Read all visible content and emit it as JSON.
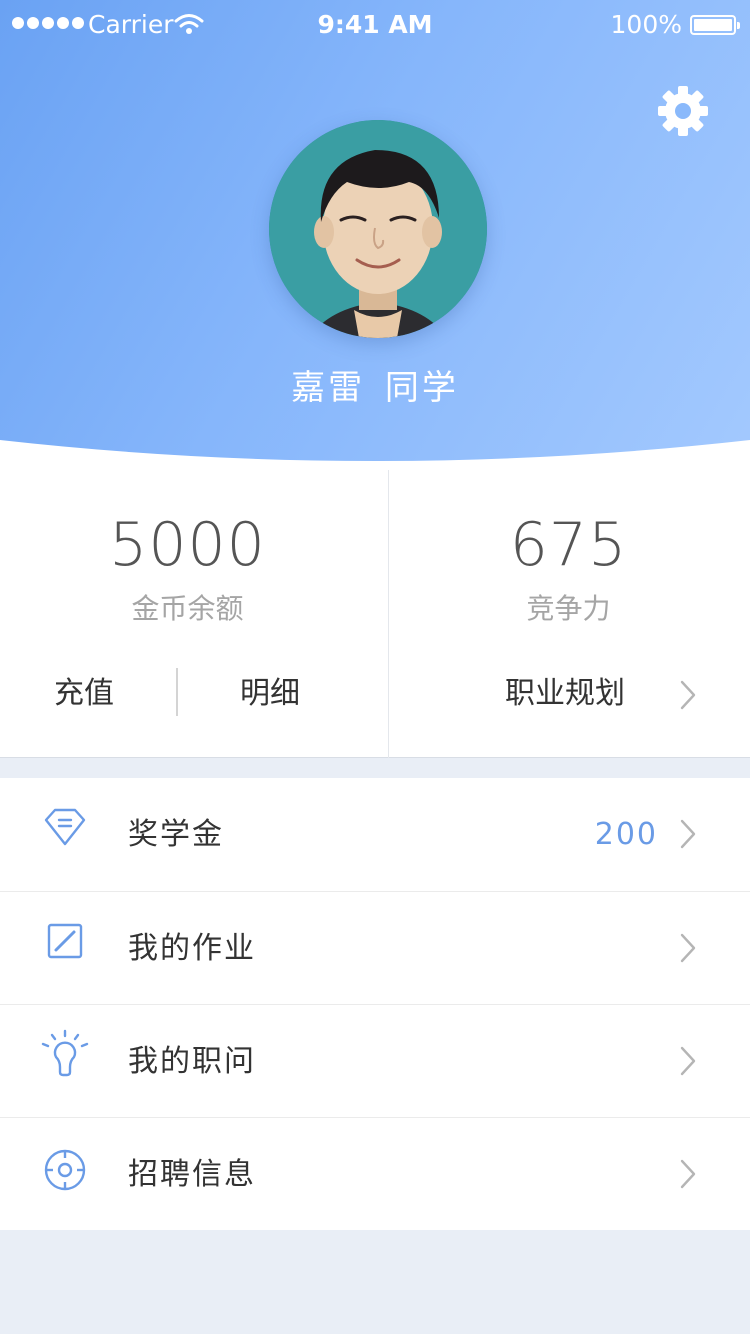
{
  "status_bar": {
    "carrier": "Carrier",
    "time": "9:41 AM",
    "battery": "100%"
  },
  "profile": {
    "name": "嘉雷 同学",
    "settings_icon": "gear-icon",
    "avatar_icon": "avatar-photo"
  },
  "stats": {
    "coins": {
      "value": "5000",
      "label": "金币余额"
    },
    "competitiveness": {
      "value": "675",
      "label": "竞争力"
    },
    "actions": {
      "recharge": "充值",
      "details": "明细",
      "career_plan": "职业规划"
    }
  },
  "menu": {
    "items": [
      {
        "label": "奖学金",
        "badge": "200",
        "icon": "diamond-icon"
      },
      {
        "label": "我的作业",
        "icon": "edit-square-icon"
      },
      {
        "label": "我的职问",
        "icon": "lightbulb-icon"
      },
      {
        "label": "招聘信息",
        "icon": "target-icon"
      }
    ]
  },
  "colors": {
    "accent": "#6a9be6",
    "header_start": "#6aa2f3",
    "header_end": "#a3c9fe",
    "page_background": "#e9eef6"
  }
}
